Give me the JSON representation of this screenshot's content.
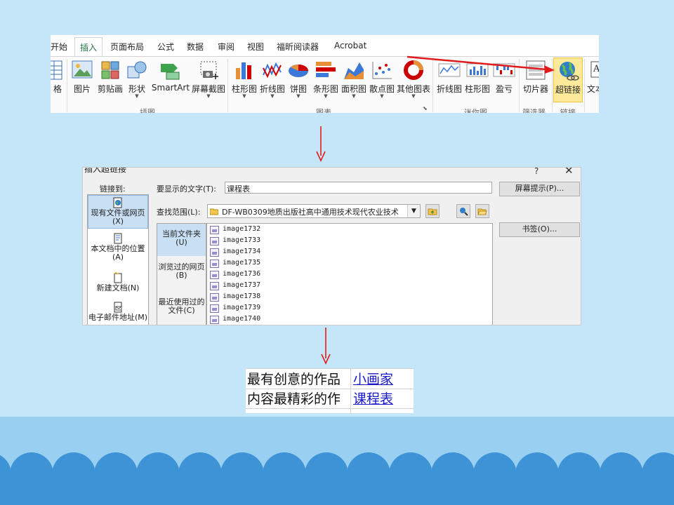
{
  "ribbon": {
    "tabs": [
      "开始",
      "插入",
      "页面布局",
      "公式",
      "数据",
      "审阅",
      "视图",
      "福昕阅读器",
      "Acrobat"
    ],
    "active_tab": "插入",
    "tools": [
      {
        "id": "table",
        "label": "格",
        "icon": "table-icon"
      },
      {
        "id": "picture",
        "label": "图片",
        "icon": "picture-icon"
      },
      {
        "id": "clipart",
        "label": "剪贴画",
        "icon": "clipart-icon"
      },
      {
        "id": "shapes",
        "label": "形状",
        "icon": "shapes-icon"
      },
      {
        "id": "smartart",
        "label": "SmartArt",
        "icon": "smartart-icon"
      },
      {
        "id": "screenshot",
        "label": "屏幕截图",
        "icon": "screenshot-icon"
      },
      {
        "id": "column-chart",
        "label": "柱形图",
        "icon": "column-chart-icon"
      },
      {
        "id": "line-chart",
        "label": "折线图",
        "icon": "line-chart-icon"
      },
      {
        "id": "pie-chart",
        "label": "饼图",
        "icon": "pie-chart-icon"
      },
      {
        "id": "bar-chart",
        "label": "条形图",
        "icon": "bar-chart-icon"
      },
      {
        "id": "area-chart",
        "label": "面积图",
        "icon": "area-chart-icon"
      },
      {
        "id": "scatter-chart",
        "label": "散点图",
        "icon": "scatter-chart-icon"
      },
      {
        "id": "other-charts",
        "label": "其他图表",
        "icon": "doughnut-chart-icon"
      },
      {
        "id": "spark-line",
        "label": "折线图",
        "icon": "sparkline-line-icon"
      },
      {
        "id": "spark-column",
        "label": "柱形图",
        "icon": "sparkline-column-icon"
      },
      {
        "id": "spark-winloss",
        "label": "盈亏",
        "icon": "sparkline-winloss-icon"
      },
      {
        "id": "slicer",
        "label": "切片器",
        "icon": "slicer-icon"
      },
      {
        "id": "hyperlink",
        "label": "超链接",
        "icon": "hyperlink-globe-icon"
      },
      {
        "id": "textbox",
        "label": "文本",
        "icon": "textbox-icon"
      }
    ],
    "groups": [
      "插图",
      "图表",
      "迷你图",
      "筛选器",
      "链接"
    ]
  },
  "dialog": {
    "title": "插入超链接",
    "help": "?",
    "close": "✕",
    "link_to_label": "链接到:",
    "link_to_items": [
      "现有文件或网页(X)",
      "本文档中的位置(A)",
      "新建文档(N)",
      "电子邮件地址(M)"
    ],
    "display_text_label": "要显示的文字(T):",
    "display_text_value": "课程表",
    "screentip_button": "屏幕提示(P)...",
    "look_in_label": "查找范围(L):",
    "look_in_value": "DF-WB0309地质出版社高中通用技术现代农业技术",
    "bookmark_button": "书签(O)...",
    "side_tabs": [
      "当前文件夹(U)",
      "浏览过的网页(B)",
      "最近使用过的文件(C)"
    ],
    "files": [
      "image1732",
      "image1733",
      "image1734",
      "image1735",
      "image1736",
      "image1737",
      "image1738",
      "image1739",
      "image1740"
    ]
  },
  "result": {
    "rows": [
      {
        "label": "最有创意的作品",
        "link": "小画家"
      },
      {
        "label": "内容最精彩的作",
        "link": "课程表"
      }
    ]
  },
  "colors": {
    "background": "#c5e5f8",
    "footer": "#99cff0",
    "scallop": "#3d93d6",
    "arrow": "#e11b1b",
    "link": "#1818c8",
    "excel_green": "#217346"
  }
}
